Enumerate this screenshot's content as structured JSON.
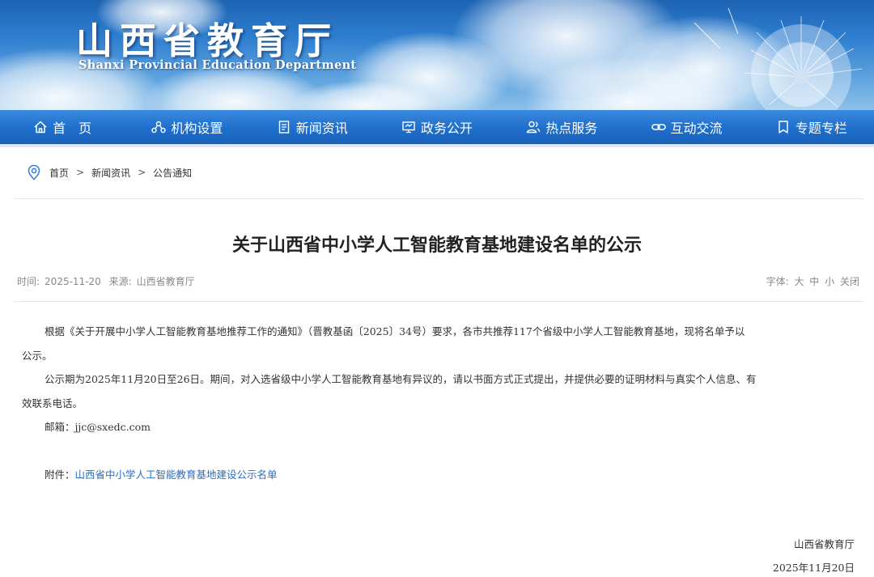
{
  "site": {
    "name_cn": "山西省教育厅",
    "name_en": "Shanxi Provincial Education Department"
  },
  "nav": [
    {
      "label": "首　页",
      "icon": "home-icon"
    },
    {
      "label": "机构设置",
      "icon": "org-structure-icon"
    },
    {
      "label": "新闻资讯",
      "icon": "news-document-icon"
    },
    {
      "label": "政务公开",
      "icon": "monitor-icon"
    },
    {
      "label": "热点服务",
      "icon": "people-service-icon"
    },
    {
      "label": "互动交流",
      "icon": "link-chain-icon"
    },
    {
      "label": "专题专栏",
      "icon": "bookmark-icon"
    }
  ],
  "breadcrumb": {
    "icon": "location-pin-icon",
    "items": [
      "首页",
      "新闻资讯",
      "公告通知"
    ],
    "separator": ">"
  },
  "article": {
    "title": "关于山西省中小学人工智能教育基地建设名单的公示",
    "time_label": "时间:",
    "time": "2025-11-20",
    "source_label": "来源:",
    "source": "山西省教育厅",
    "font_label": "字体:",
    "font_large": "大",
    "font_medium": "中",
    "font_small": "小",
    "close": "关闭",
    "p1_line1": "根据《关于开展中小学人工智能教育基地推荐工作的通知》（晋教基函〔2025〕34号）要求，各市共推荐117个省级中小学人工智能教育基地，现将名单予以",
    "p1_line2": "公示。",
    "p2_line1": "公示期为2025年11月20日至26日。期间，对入选省级中小学人工智能教育基地有异议的，请以书面方式正式提出，并提供必要的证明材料与真实个人信息、有",
    "p2_line2": "效联系电话。",
    "email_label": "邮箱：",
    "email": "jjc@sxedc.com",
    "attachment_label": "附件：",
    "attachment_link": "山西省中小学人工智能教育基地建设公示名单",
    "sign_org": "山西省教育厅",
    "sign_date": "2025年11月20日"
  },
  "colors": {
    "nav_bg": "#1f6fcc",
    "link": "#2b6cbf",
    "banner_sky": "#2f7fd0"
  }
}
